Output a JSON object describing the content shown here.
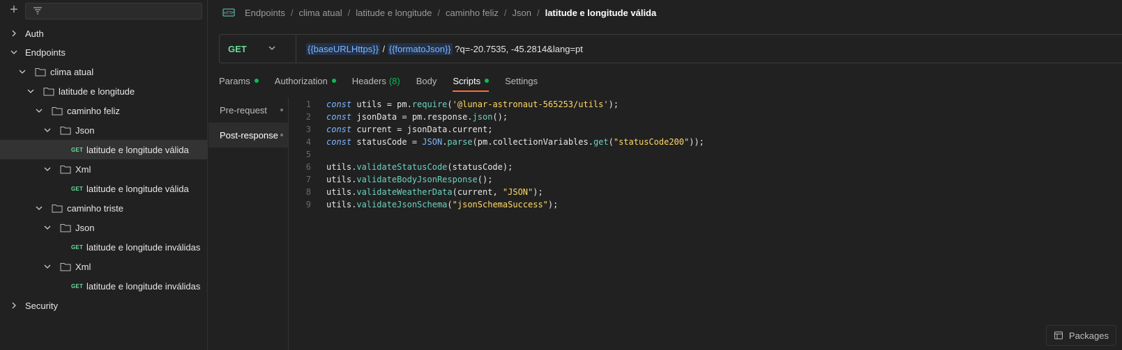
{
  "sidebar": {
    "tree": [
      {
        "label": "Auth",
        "type": "collection",
        "expanded": false
      },
      {
        "label": "Endpoints",
        "type": "collection",
        "expanded": true
      },
      {
        "label": "clima atual",
        "type": "folder",
        "expanded": true
      },
      {
        "label": "latitude e longitude",
        "type": "folder",
        "expanded": true
      },
      {
        "label": "caminho feliz",
        "type": "folder",
        "expanded": true
      },
      {
        "label": "Json",
        "type": "folder",
        "expanded": true
      },
      {
        "label": "latitude e longitude válida",
        "type": "request",
        "method": "GET",
        "selected": true
      },
      {
        "label": "Xml",
        "type": "folder",
        "expanded": true
      },
      {
        "label": "latitude e longitude válida",
        "type": "request",
        "method": "GET"
      },
      {
        "label": "caminho triste",
        "type": "folder",
        "expanded": true
      },
      {
        "label": "Json",
        "type": "folder",
        "expanded": true
      },
      {
        "label": "latitude e longitude inválidas",
        "type": "request",
        "method": "GET"
      },
      {
        "label": "Xml",
        "type": "folder",
        "expanded": true
      },
      {
        "label": "latitude e longitude inválidas",
        "type": "request",
        "method": "GET"
      },
      {
        "label": "Security",
        "type": "collection",
        "expanded": false
      }
    ]
  },
  "breadcrumb": {
    "icon": "http-icon",
    "items": [
      "Endpoints",
      "clima atual",
      "latitude e longitude",
      "caminho feliz",
      "Json"
    ],
    "current": "latitude e longitude válida"
  },
  "request": {
    "method": "GET",
    "url_var1": "{{baseURLHttps}}",
    "url_sep": " / ",
    "url_var2": "{{formatoJson}}",
    "url_rest": " ?q=-20.7535, -45.2814&lang=pt"
  },
  "tabs": [
    {
      "label": "Params",
      "dot": true
    },
    {
      "label": "Authorization",
      "dot": true
    },
    {
      "label": "Headers",
      "count": "(8)"
    },
    {
      "label": "Body"
    },
    {
      "label": "Scripts",
      "dot": true,
      "active": true
    },
    {
      "label": "Settings"
    }
  ],
  "scripts": {
    "pre_request": "Pre-request",
    "post_response": "Post-response"
  },
  "code_lines": [
    "1",
    "2",
    "3",
    "4",
    "5",
    "6",
    "7",
    "8",
    "9"
  ],
  "code": {
    "l1": {
      "kw": "const",
      "a": " utils = pm.",
      "fn": "require",
      "b": "(",
      "str": "'@lunar-astronaut-565253/utils'",
      "c": ");"
    },
    "l2": {
      "kw": "const",
      "a": " jsonData = pm.response.",
      "fn": "json",
      "b": "();"
    },
    "l3": {
      "kw": "const",
      "a": " current = jsonData.current;"
    },
    "l4": {
      "kw": "const",
      "a": " statusCode = ",
      "cls": "JSON",
      "b": ".",
      "fn": "parse",
      "c": "(pm.collectionVariables.",
      "fn2": "get",
      "d": "(",
      "str": "\"statusCode200\"",
      "e": "));"
    },
    "l6": {
      "a": "utils.",
      "fn": "validateStatusCode",
      "b": "(statusCode);"
    },
    "l7": {
      "a": "utils.",
      "fn": "validateBodyJsonResponse",
      "b": "();"
    },
    "l8": {
      "a": "utils.",
      "fn": "validateWeatherData",
      "b": "(current, ",
      "str": "\"JSON\"",
      "c": ");"
    },
    "l9": {
      "a": "utils.",
      "fn": "validateJsonSchema",
      "b": "(",
      "str": "\"jsonSchemaSuccess\"",
      "c": ");"
    }
  },
  "footer": {
    "packages_label": "Packages"
  },
  "colors": {
    "accent": "#ff6c37",
    "get": "#6bdd9a",
    "dot": "#0cbb52",
    "variable": "#7fb6ff"
  }
}
